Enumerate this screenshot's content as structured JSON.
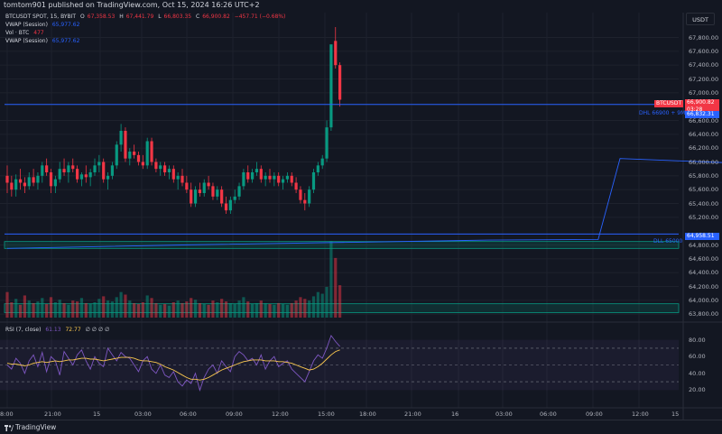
{
  "header": {
    "publish_text": "tomtom901 published on TradingView.com, Oct 15, 2024 16:26 UTC+2"
  },
  "legend": {
    "symbol": "BTCUSDT SPOT, 15, BYBIT",
    "o_label": "O",
    "o_value": "67,358.53",
    "h_label": "H",
    "h_value": "67,441.79",
    "l_label": "L",
    "l_value": "66,803.35",
    "c_label": "C",
    "c_value": "66,900.82",
    "change": "−457.71 (−0.68%)",
    "vwap1_label": "VWAP (Session)",
    "vwap1_value": "65,977.62",
    "vol_label": "Vol · BTC",
    "vol_value": "477",
    "vwap2_label": "VWAP (Session)",
    "vwap2_value": "65,977.62"
  },
  "currency_button": "USDT",
  "price_axis": [
    "67,800.00",
    "67,600.00",
    "67,400.00",
    "67,200.00",
    "67,000.00",
    "66,600.00",
    "66,400.00",
    "66,200.00",
    "66,000.00",
    "65,800.00",
    "65,600.00",
    "65,400.00",
    "65,200.00",
    "64,800.00",
    "64,600.00",
    "64,400.00",
    "64,200.00",
    "64,000.00",
    "63,800.00"
  ],
  "price_tags": {
    "symbol": "BTCUSDT",
    "price": "66,900.82",
    "countdown": "03:28",
    "dhl_label": "DHL 66900 + 9MH",
    "dhl_price": "66,832.31",
    "dll_price": "64,958.51",
    "dll_label": "DLL 65000"
  },
  "rsi": {
    "label": "RSI (7, close)",
    "value1": "61.13",
    "value2": "72.77",
    "placeholders": "∅ ∅ ∅ ∅",
    "axis": [
      "80.00",
      "60.00",
      "40.00",
      "20.00"
    ]
  },
  "time_axis": [
    "8:00",
    "21:00",
    "15",
    "03:00",
    "06:00",
    "09:00",
    "12:00",
    "15:00",
    "18:00",
    "21:00",
    "16",
    "03:00",
    "06:00",
    "09:00",
    "12:00",
    "15"
  ],
  "footer": {
    "brand": "TradingView"
  },
  "colors": {
    "up": "#089981",
    "down": "#f23645",
    "vwap": "#2962ff",
    "rsi": "#7e57c2",
    "rsi_ma": "#f9c74f",
    "bg": "#131722"
  },
  "chart_data": {
    "type": "candlestick",
    "symbol": "BTCUSDT",
    "interval": "15",
    "price_range": [
      63750,
      67950
    ],
    "candles": [
      [
        65800,
        65950,
        65550,
        65700
      ],
      [
        65700,
        65800,
        65500,
        65600
      ],
      [
        65600,
        65820,
        65500,
        65750
      ],
      [
        65750,
        65900,
        65600,
        65700
      ],
      [
        65700,
        65780,
        65550,
        65650
      ],
      [
        65650,
        65850,
        65600,
        65780
      ],
      [
        65780,
        65900,
        65650,
        65700
      ],
      [
        65700,
        65850,
        65600,
        65800
      ],
      [
        65800,
        66000,
        65700,
        65950
      ],
      [
        65950,
        66050,
        65800,
        65850
      ],
      [
        65850,
        65900,
        65550,
        65650
      ],
      [
        65650,
        65800,
        65550,
        65750
      ],
      [
        65750,
        66000,
        65700,
        65900
      ],
      [
        65900,
        66050,
        65800,
        65850
      ],
      [
        65850,
        66000,
        65700,
        65950
      ],
      [
        65950,
        66050,
        65850,
        65900
      ],
      [
        65900,
        65950,
        65700,
        65750
      ],
      [
        65750,
        65850,
        65650,
        65820
      ],
      [
        65820,
        65950,
        65700,
        65780
      ],
      [
        65780,
        65900,
        65650,
        65850
      ],
      [
        65850,
        66050,
        65800,
        65950
      ],
      [
        65950,
        66100,
        65850,
        66000
      ],
      [
        66000,
        66050,
        65700,
        65750
      ],
      [
        65750,
        65850,
        65600,
        65800
      ],
      [
        65800,
        66000,
        65750,
        65950
      ],
      [
        65950,
        66300,
        65900,
        66250
      ],
      [
        66250,
        66550,
        66150,
        66450
      ],
      [
        66450,
        66500,
        66000,
        66050
      ],
      [
        66050,
        66200,
        65950,
        66150
      ],
      [
        66150,
        66250,
        66050,
        66100
      ],
      [
        66100,
        66150,
        65950,
        66000
      ],
      [
        66000,
        66100,
        65900,
        65950
      ],
      [
        65950,
        66350,
        65900,
        66300
      ],
      [
        66300,
        66350,
        65950,
        66000
      ],
      [
        66000,
        66050,
        65850,
        65900
      ],
      [
        65900,
        66000,
        65800,
        65950
      ],
      [
        65950,
        66000,
        65800,
        65850
      ],
      [
        65850,
        65950,
        65750,
        65900
      ],
      [
        65900,
        65950,
        65700,
        65750
      ],
      [
        65750,
        65850,
        65600,
        65800
      ],
      [
        65800,
        65900,
        65650,
        65700
      ],
      [
        65700,
        65800,
        65550,
        65600
      ],
      [
        65600,
        65700,
        65350,
        65400
      ],
      [
        65400,
        65650,
        65350,
        65600
      ],
      [
        65600,
        65700,
        65500,
        65550
      ],
      [
        65550,
        65750,
        65500,
        65700
      ],
      [
        65700,
        65800,
        65600,
        65650
      ],
      [
        65650,
        65700,
        65450,
        65500
      ],
      [
        65500,
        65650,
        65450,
        65600
      ],
      [
        65600,
        65650,
        65350,
        65400
      ],
      [
        65400,
        65500,
        65250,
        65300
      ],
      [
        65300,
        65500,
        65250,
        65450
      ],
      [
        65450,
        65600,
        65400,
        65500
      ],
      [
        65500,
        65700,
        65450,
        65650
      ],
      [
        65650,
        65900,
        65600,
        65850
      ],
      [
        65850,
        65950,
        65700,
        65750
      ],
      [
        65750,
        65900,
        65700,
        65850
      ],
      [
        65850,
        66000,
        65800,
        65900
      ],
      [
        65900,
        65950,
        65700,
        65750
      ],
      [
        65750,
        65850,
        65650,
        65800
      ],
      [
        65800,
        65900,
        65700,
        65750
      ],
      [
        65750,
        65850,
        65650,
        65800
      ],
      [
        65800,
        65850,
        65650,
        65700
      ],
      [
        65700,
        65800,
        65600,
        65750
      ],
      [
        65750,
        65850,
        65700,
        65800
      ],
      [
        65800,
        65850,
        65650,
        65700
      ],
      [
        65700,
        65780,
        65550,
        65600
      ],
      [
        65600,
        65650,
        65400,
        65450
      ],
      [
        65450,
        65550,
        65300,
        65400
      ],
      [
        65400,
        65650,
        65350,
        65600
      ],
      [
        65600,
        65900,
        65550,
        65850
      ],
      [
        65850,
        66000,
        65800,
        65950
      ],
      [
        65950,
        66100,
        65900,
        66050
      ],
      [
        66050,
        66600,
        66000,
        66500
      ],
      [
        66500,
        67650,
        66450,
        67700
      ],
      [
        67750,
        67950,
        67350,
        67400
      ],
      [
        67400,
        67440,
        66800,
        66900
      ]
    ],
    "volume": [
      300,
      180,
      220,
      150,
      260,
      200,
      170,
      190,
      230,
      160,
      240,
      180,
      210,
      170,
      150,
      200,
      190,
      230,
      170,
      160,
      180,
      220,
      250,
      200,
      190,
      240,
      300,
      270,
      200,
      170,
      160,
      180,
      260,
      230,
      170,
      150,
      160,
      140,
      180,
      200,
      170,
      190,
      230,
      210,
      170,
      160,
      150,
      200,
      180,
      220,
      190,
      170,
      160,
      200,
      240,
      190,
      160,
      170,
      200,
      170,
      160,
      150,
      170,
      160,
      150,
      170,
      200,
      240,
      220,
      200,
      250,
      300,
      280,
      360,
      900,
      700,
      380
    ],
    "vwap": [
      [
        0,
        64750
      ],
      [
        40,
        64800
      ],
      [
        80,
        64840
      ],
      [
        110,
        64870
      ],
      [
        135,
        64880
      ],
      [
        140,
        66050
      ],
      [
        160,
        66000
      ],
      [
        180,
        65950
      ],
      [
        200,
        65900
      ],
      [
        220,
        65850
      ],
      [
        240,
        65780
      ],
      [
        260,
        65750
      ],
      [
        290,
        65740
      ],
      [
        320,
        65720
      ],
      [
        340,
        65700
      ],
      [
        360,
        65760
      ],
      [
        370,
        65850
      ],
      [
        380,
        66000
      ]
    ],
    "levels": {
      "dhl": 66832.31,
      "dll": 64958.51,
      "zone1": [
        64750,
        64850
      ],
      "zone2": [
        63900,
        63950
      ]
    },
    "rsi": [
      50,
      45,
      58,
      52,
      40,
      55,
      62,
      48,
      65,
      42,
      60,
      55,
      38,
      66,
      58,
      50,
      62,
      68,
      55,
      45,
      60,
      52,
      48,
      70,
      62,
      55,
      65,
      60,
      58,
      50,
      42,
      55,
      60,
      45,
      40,
      50,
      38,
      35,
      42,
      30,
      25,
      32,
      28,
      40,
      20,
      35,
      45,
      50,
      40,
      55,
      48,
      42,
      60,
      66,
      62,
      55,
      58,
      50,
      62,
      45,
      55,
      60,
      48,
      52,
      55,
      45,
      40,
      35,
      30,
      42,
      55,
      62,
      58,
      70,
      85,
      78,
      72
    ],
    "rsi_ma": [
      52,
      51,
      51,
      50,
      49,
      50,
      52,
      53,
      54,
      53,
      54,
      55,
      54,
      55,
      56,
      56,
      57,
      58,
      58,
      57,
      57,
      56,
      55,
      56,
      57,
      58,
      59,
      59,
      59,
      58,
      56,
      55,
      55,
      54,
      53,
      51,
      48,
      46,
      44,
      41,
      38,
      35,
      33,
      33,
      32,
      33,
      35,
      38,
      41,
      44,
      46,
      48,
      50,
      52,
      54,
      55,
      56,
      56,
      56,
      55,
      55,
      55,
      54,
      54,
      53,
      52,
      50,
      48,
      46,
      44,
      45,
      48,
      52,
      57,
      62,
      66,
      68
    ],
    "rsi_range": [
      0,
      100
    ],
    "rsi_levels": [
      70,
      50,
      30
    ]
  }
}
